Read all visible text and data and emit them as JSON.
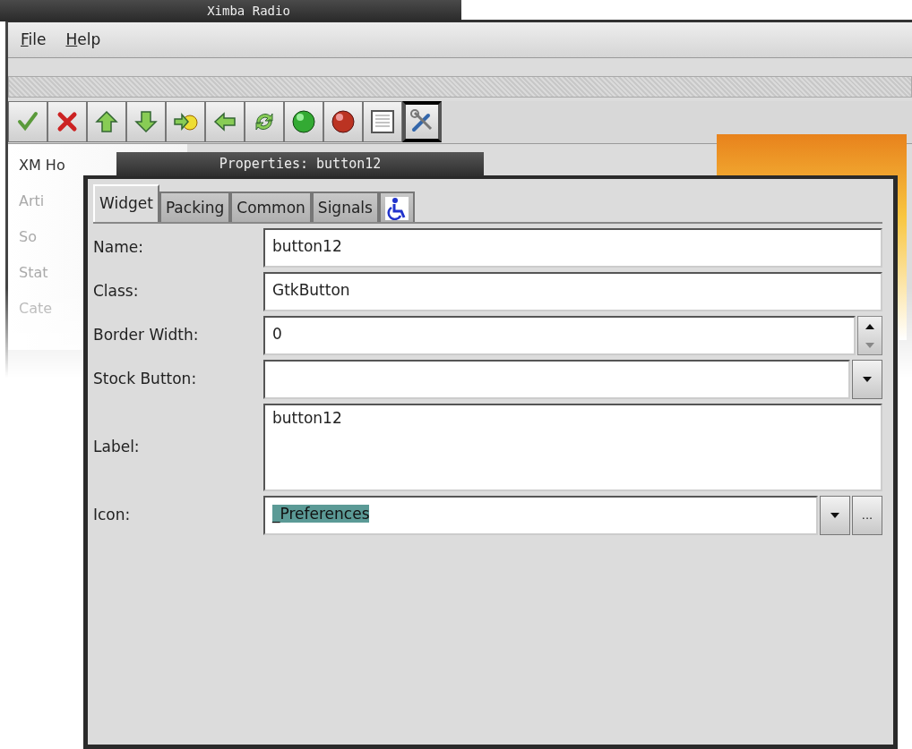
{
  "main_window": {
    "title": "Ximba Radio",
    "menu": [
      {
        "label": "File",
        "mnemonic": true
      },
      {
        "label": "Help",
        "mnemonic": true
      }
    ],
    "toolbar": [
      {
        "kind": "check",
        "selected": false
      },
      {
        "kind": "cross",
        "selected": false
      },
      {
        "kind": "up",
        "selected": false
      },
      {
        "kind": "down",
        "selected": false
      },
      {
        "kind": "forward",
        "selected": false
      },
      {
        "kind": "back",
        "selected": false
      },
      {
        "kind": "refresh",
        "selected": false
      },
      {
        "kind": "green",
        "selected": false
      },
      {
        "kind": "red",
        "selected": false
      },
      {
        "kind": "list",
        "selected": false
      },
      {
        "kind": "tools",
        "selected": true
      }
    ],
    "sidebar_labels": [
      "XM Ho",
      "Arti",
      "So",
      "Stat",
      "Cate"
    ]
  },
  "properties": {
    "title": "Properties: button12",
    "tabs": [
      {
        "kind": "text",
        "label": "Widget",
        "selected": true
      },
      {
        "kind": "text",
        "label": "Packing",
        "selected": false
      },
      {
        "kind": "text",
        "label": "Common",
        "selected": false
      },
      {
        "kind": "text",
        "label": "Signals",
        "selected": false
      },
      {
        "kind": "accessibility",
        "selected": false
      }
    ],
    "fields": [
      {
        "kind": "entry",
        "label": "Name:",
        "value": "button12"
      },
      {
        "kind": "entry",
        "label": "Class:",
        "value": "GtkButton"
      },
      {
        "kind": "spin",
        "label": "Border Width:",
        "value": "0"
      },
      {
        "kind": "combo",
        "label": "Stock Button:"
      },
      {
        "kind": "textarea",
        "label": "Label:",
        "value": "button12"
      },
      {
        "kind": "combo_browse",
        "label": "Icon:",
        "value": "_Preferences",
        "text_selected": true,
        "browse_label": "..."
      }
    ]
  }
}
